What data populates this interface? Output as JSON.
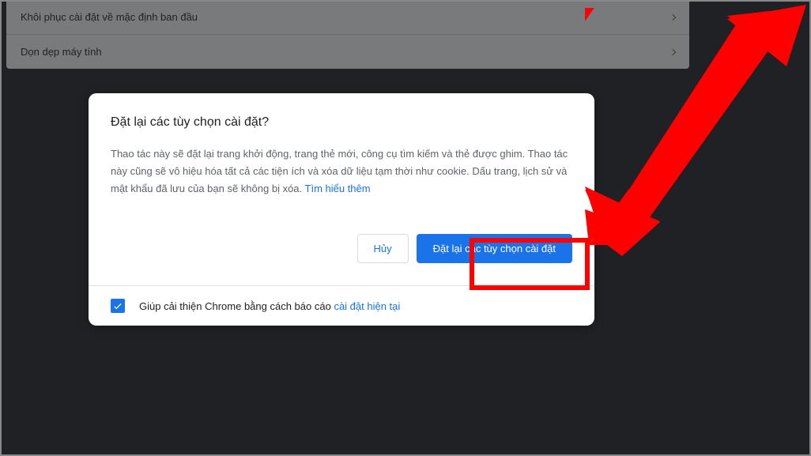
{
  "background": {
    "rows": [
      {
        "label": "Khôi phục cài đặt về mặc định ban đầu"
      },
      {
        "label": "Dọn dẹp máy tính"
      }
    ]
  },
  "dialog": {
    "title": "Đặt lại các tùy chọn cài đặt?",
    "description_pre": "Thao tác này sẽ đặt lại trang khởi động, trang thẻ mới, công cụ tìm kiếm và thẻ được ghim. Thao tác này cũng sẽ vô hiệu hóa tất cả các tiện ích và xóa dữ liệu tạm thời như cookie. Dấu trang, lịch sử và mật khẩu đã lưu của bạn sẽ không bị xóa. ",
    "learn_more": "Tìm hiểu thêm",
    "actions": {
      "cancel": "Hủy",
      "confirm": "Đặt lại các tùy chọn cài đặt"
    },
    "footer": {
      "checked": true,
      "text_pre": "Giúp cải thiện Chrome bằng cách báo cáo ",
      "link": "cài đặt hiện tại"
    }
  }
}
